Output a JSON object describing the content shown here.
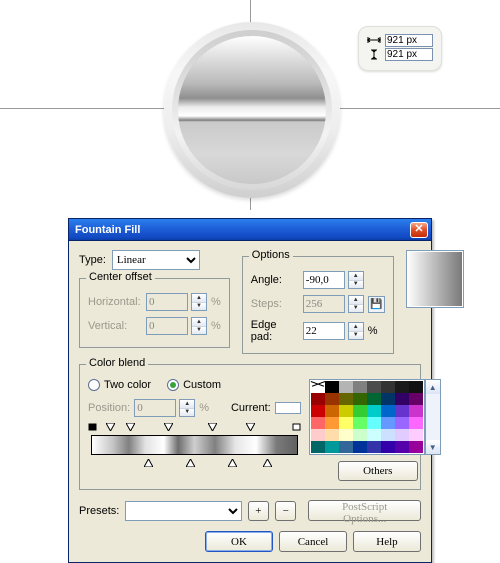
{
  "canvas": {
    "width_value": "921 px",
    "height_value": "921 px"
  },
  "dialog": {
    "title": "Fountain Fill",
    "type_label": "Type:",
    "type_value": "Linear",
    "center_offset": {
      "legend": "Center offset",
      "horizontal_label": "Horizontal:",
      "horizontal_value": "0",
      "vertical_label": "Vertical:",
      "vertical_value": "0",
      "pct": "%"
    },
    "options": {
      "legend": "Options",
      "angle_label": "Angle:",
      "angle_value": "-90,0",
      "steps_label": "Steps:",
      "steps_value": "256",
      "edgepad_label": "Edge pad:",
      "edgepad_value": "22",
      "pct": "%"
    },
    "color_blend": {
      "legend": "Color blend",
      "two_color": "Two color",
      "custom": "Custom",
      "position_label": "Position:",
      "position_value": "0",
      "pct": "%",
      "current_label": "Current:",
      "others": "Others"
    },
    "presets_label": "Presets:",
    "postscript": "PostScript Options...",
    "buttons": {
      "ok": "OK",
      "cancel": "Cancel",
      "help": "Help"
    }
  },
  "palette_colors": [
    "x",
    "#000000",
    "#b4b4b4",
    "#808080",
    "#4c4c4c",
    "#333333",
    "#1a1a1a",
    "#111111",
    "#990000",
    "#993300",
    "#666600",
    "#336600",
    "#006633",
    "#003366",
    "#330066",
    "#660066",
    "#cc0000",
    "#cc6600",
    "#cccc00",
    "#33cc33",
    "#00cccc",
    "#0066cc",
    "#6633cc",
    "#cc33cc",
    "#ff6666",
    "#ff9933",
    "#ffff66",
    "#66ff66",
    "#66ffff",
    "#6699ff",
    "#9966ff",
    "#ff66ff",
    "#ffcccc",
    "#ffddaa",
    "#ffffcc",
    "#ccffcc",
    "#ccffff",
    "#cce0ff",
    "#e0ccff",
    "#ffccff",
    "#006666",
    "#009999",
    "#336699",
    "#003399",
    "#3333aa",
    "#3300aa",
    "#5500aa",
    "#990099"
  ]
}
